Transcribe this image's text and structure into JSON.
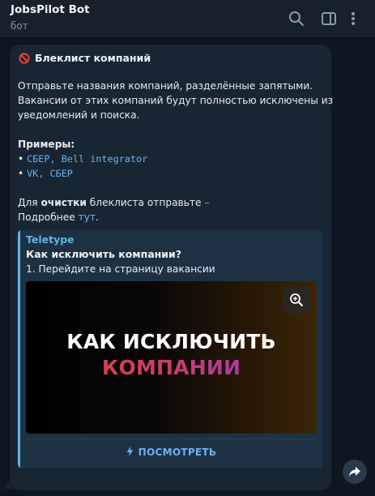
{
  "header": {
    "bot_name": "JobsPilot Bot",
    "status": "бот",
    "icons": [
      "search-icon",
      "sidebar-toggle-icon",
      "more-vertical-icon"
    ]
  },
  "message": {
    "title": "Блеклист компаний",
    "title_icon": "no-entry-icon",
    "paragraph_lines": [
      "Отправьте названия компаний, разделённые запятыми.",
      "Вакансии от этих компаний будут полностью исключены из",
      "уведомлений и поиска."
    ],
    "examples_label": "Примеры:",
    "examples": [
      "СБЕР, Bell integrator",
      "VK, СБЕР"
    ],
    "clear_prefix": "Для ",
    "clear_bold": "очистки",
    "clear_suffix": " блеклиста отправьте ",
    "clear_symbol": "–",
    "more_prefix": "Подробнее ",
    "more_link": "тут",
    "more_suffix": "."
  },
  "preview": {
    "site": "Teletype",
    "title": "Как исключить компании?",
    "description": "1. Перейдите на страницу вакансии",
    "image_line1": "КАК ИСКЛЮЧИТЬ",
    "image_line2": "КОМПАНИИ",
    "button_label": "ПОСМОТРЕТЬ",
    "button_icon": "lightning-icon"
  },
  "colors": {
    "background": "#0e1621",
    "header": "#17212b",
    "bubble": "#182533",
    "accent": "#6ab3f3",
    "preview_bar": "#5fb5e8"
  }
}
